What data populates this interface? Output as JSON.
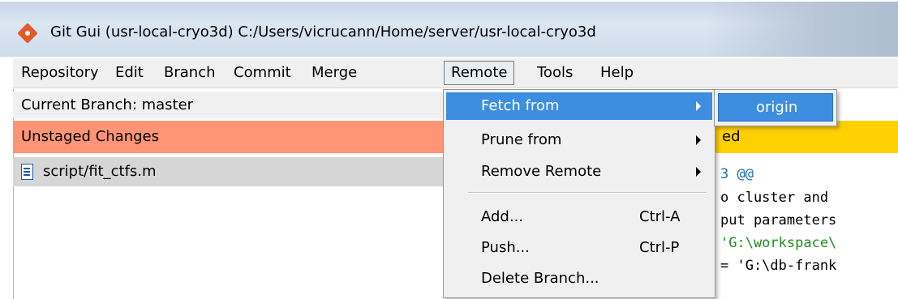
{
  "window": {
    "title": "Git Gui (usr-local-cryo3d) C:/Users/vicrucann/Home/server/usr-local-cryo3d"
  },
  "menubar": {
    "items": [
      {
        "label": "Repository"
      },
      {
        "label": "Edit"
      },
      {
        "label": "Branch"
      },
      {
        "label": "Commit"
      },
      {
        "label": "Merge"
      },
      {
        "label": "Remote",
        "active": true
      },
      {
        "label": "Tools"
      },
      {
        "label": "Help"
      }
    ]
  },
  "status": {
    "current_branch": "Current Branch: master"
  },
  "unstaged": {
    "header": "Unstaged Changes",
    "files": [
      {
        "path": "script/fit_ctfs.m"
      }
    ]
  },
  "diff": {
    "header_fragment": "ed",
    "lines": [
      {
        "text": "3 @@",
        "color": "#1a6fb0"
      },
      {
        "text": "o cluster and",
        "color": "#000000"
      },
      {
        "text": "put parameters",
        "color": "#000000"
      },
      {
        "text": "'G:\\workspace\\",
        "color": "#1e8c1e"
      },
      {
        "text": "= 'G:\\db-frank",
        "color": "#000000"
      }
    ]
  },
  "remote_menu": {
    "items": [
      {
        "label": "Fetch from",
        "submenu": true,
        "highlight": true
      },
      {
        "label": "Prune from",
        "submenu": true
      },
      {
        "label": "Remove Remote",
        "submenu": true
      },
      {
        "label": "Add...",
        "shortcut": "Ctrl-A"
      },
      {
        "label": "Push...",
        "shortcut": "Ctrl-P"
      },
      {
        "label": "Delete Branch..."
      }
    ]
  },
  "fetch_submenu": {
    "items": [
      {
        "label": "origin"
      }
    ]
  },
  "colors": {
    "highlight": "#3d8ee0",
    "unstaged_header": "#ff9575",
    "staged_header": "#ffd000",
    "file_row": "#d6d6d6"
  }
}
